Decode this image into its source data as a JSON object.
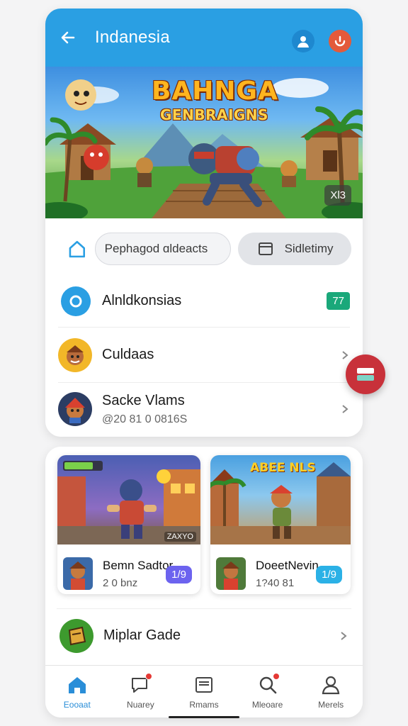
{
  "header": {
    "title": "Indanesia",
    "back_icon": "arrow-left-icon",
    "user_icon": "user-icon",
    "alert_icon": "alert-icon",
    "colors": {
      "bar": "#2a9fe3",
      "alert": "#e35a3a"
    }
  },
  "banner": {
    "title": "BAHNGA",
    "subtitle": "GENBRAIGNS",
    "badge": "Xl3"
  },
  "search": {
    "home_icon": "home-icon",
    "placeholder": "Pephagod ɑldeacts",
    "sidebar_label": "Sidletimy",
    "sidebar_icon": "sidebar-icon"
  },
  "list": [
    {
      "title": "Alnldkonsias",
      "badge": "77",
      "icon": "location-icon"
    },
    {
      "title": "Culdaas",
      "icon": "character-avatar"
    },
    {
      "title": "Sacke Vlams",
      "subtitle": "@20 81 0 0816S",
      "icon": "character-avatar"
    }
  ],
  "fab": {
    "icon": "layers-icon"
  },
  "games": [
    {
      "name": "Bemn Sadtor",
      "sub": "2 0 bnz",
      "count": "1/9",
      "color": "#6c63ef",
      "art_label": "ZAXYO"
    },
    {
      "name": "DoeetNevin",
      "sub": "1?40 81",
      "count": "1/9",
      "color": "#2bb1e6",
      "art_title": "ABEE NLS"
    }
  ],
  "featured": {
    "title": "Miplar Gade",
    "icon": "game-icon"
  },
  "nav": [
    {
      "label": "Eooaat",
      "icon": "home-icon",
      "active": true
    },
    {
      "label": "Nuarey",
      "icon": "chat-icon",
      "dot": true
    },
    {
      "label": "Rmams",
      "icon": "card-icon"
    },
    {
      "label": "Mleoare",
      "icon": "search-icon",
      "dot": true
    },
    {
      "label": "Merels",
      "icon": "profile-icon"
    }
  ]
}
